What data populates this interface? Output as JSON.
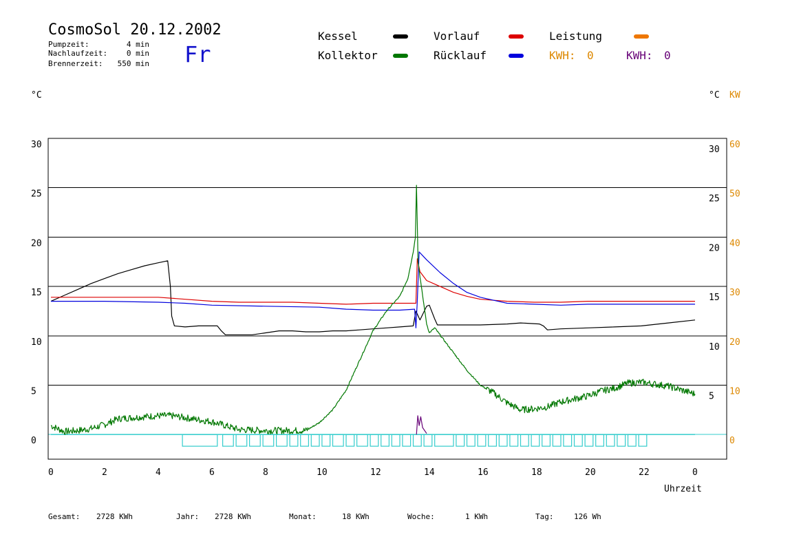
{
  "header": {
    "title": "CosmoSol 20.12.2002",
    "day": "Fr",
    "stats": [
      {
        "label": "Pumpzeit:",
        "value": "4 min"
      },
      {
        "label": "Nachlaufzeit:",
        "value": "0 min"
      },
      {
        "label": "Brennerzeit:",
        "value": "550 min"
      }
    ]
  },
  "legend": {
    "items": [
      {
        "label": "Kessel",
        "color": "#000000"
      },
      {
        "label": "Vorlauf",
        "color": "#dd0000"
      },
      {
        "label": "Leistung",
        "color": "#ee7700"
      },
      {
        "label": "Kollektor",
        "color": "#007700"
      },
      {
        "label": "Rücklauf",
        "color": "#0000dd"
      }
    ],
    "kwh": [
      {
        "label": "KWH:",
        "value": "0",
        "color": "#dd8800"
      },
      {
        "label": "KWH:",
        "value": "0",
        "color": "#660077"
      }
    ]
  },
  "footer": {
    "items": [
      {
        "label": "Gesamt:",
        "value": "2728 KWh"
      },
      {
        "label": "Jahr:",
        "value": "2728 KWh"
      },
      {
        "label": "Monat:",
        "value": "18 KWh"
      },
      {
        "label": "Woche:",
        "value": "1 KWh"
      },
      {
        "label": "Tag:",
        "value": "126 Wh"
      }
    ]
  },
  "chart_data": {
    "type": "line",
    "xlabel": "Uhrzeit",
    "ylabel_left": "°C",
    "ylabel_right": [
      "°C",
      "KW"
    ],
    "xlim": [
      0,
      24
    ],
    "ylim": [
      -2.5,
      30
    ],
    "ylim_kw": [
      -5,
      60
    ],
    "x_ticks": [
      "0",
      "2",
      "4",
      "6",
      "8",
      "10",
      "12",
      "14",
      "16",
      "18",
      "20",
      "22",
      "0"
    ],
    "y_ticks_left": [
      "0",
      "5",
      "10",
      "15",
      "20",
      "25",
      "30"
    ],
    "y_ticks_right": [
      "5",
      "10",
      "15",
      "20",
      "25",
      "30"
    ],
    "y_ticks_kw": [
      "0",
      "10",
      "20",
      "30",
      "40",
      "50",
      "60"
    ],
    "grid": "horizontal",
    "colors": {
      "kessel": "#000000",
      "vorlauf": "#dd0000",
      "ruecklauf": "#0000dd",
      "kollektor": "#007700",
      "pump": "#33cccc",
      "leistung": "#ee7700",
      "spike": "#660077"
    },
    "series": [
      {
        "name": "Kessel",
        "points": [
          [
            0,
            13.5
          ],
          [
            0.5,
            14.1
          ],
          [
            1,
            14.7
          ],
          [
            1.5,
            15.3
          ],
          [
            2,
            15.8
          ],
          [
            2.5,
            16.3
          ],
          [
            3,
            16.7
          ],
          [
            3.5,
            17.1
          ],
          [
            4,
            17.4
          ],
          [
            4.35,
            17.6
          ],
          [
            4.45,
            15
          ],
          [
            4.5,
            12
          ],
          [
            4.6,
            11
          ],
          [
            5,
            10.9
          ],
          [
            5.5,
            11
          ],
          [
            6.2,
            11.0
          ],
          [
            6.35,
            10.5
          ],
          [
            6.5,
            10.1
          ],
          [
            7,
            10.1
          ],
          [
            7.5,
            10.1
          ],
          [
            8,
            10.3
          ],
          [
            8.5,
            10.5
          ],
          [
            9,
            10.5
          ],
          [
            9.5,
            10.4
          ],
          [
            10,
            10.4
          ],
          [
            10.5,
            10.5
          ],
          [
            11,
            10.5
          ],
          [
            11.5,
            10.6
          ],
          [
            12,
            10.7
          ],
          [
            12.5,
            10.8
          ],
          [
            13,
            10.9
          ],
          [
            13.5,
            11.0
          ],
          [
            13.6,
            12.5
          ],
          [
            13.75,
            11.6
          ],
          [
            14,
            13.0
          ],
          [
            14.1,
            13.1
          ],
          [
            14.3,
            11.7
          ],
          [
            14.4,
            11.1
          ],
          [
            15,
            11.1
          ],
          [
            16,
            11.1
          ],
          [
            17,
            11.2
          ],
          [
            17.5,
            11.3
          ],
          [
            18.2,
            11.2
          ],
          [
            18.35,
            11.0
          ],
          [
            18.5,
            10.6
          ],
          [
            19,
            10.7
          ],
          [
            20,
            10.8
          ],
          [
            21,
            10.9
          ],
          [
            22,
            11.0
          ],
          [
            23,
            11.3
          ],
          [
            24,
            11.6
          ]
        ]
      },
      {
        "name": "Vorlauf",
        "points": [
          [
            0,
            13.9
          ],
          [
            2,
            13.9
          ],
          [
            4,
            13.9
          ],
          [
            5,
            13.7
          ],
          [
            6,
            13.5
          ],
          [
            7,
            13.4
          ],
          [
            8,
            13.4
          ],
          [
            9,
            13.4
          ],
          [
            10,
            13.3
          ],
          [
            11,
            13.2
          ],
          [
            12,
            13.3
          ],
          [
            13,
            13.3
          ],
          [
            13.6,
            13.3
          ],
          [
            13.65,
            17.8
          ],
          [
            13.75,
            16.5
          ],
          [
            14,
            15.6
          ],
          [
            14.5,
            15.0
          ],
          [
            15,
            14.4
          ],
          [
            15.5,
            14.0
          ],
          [
            16,
            13.7
          ],
          [
            16.5,
            13.6
          ],
          [
            17,
            13.5
          ],
          [
            18,
            13.4
          ],
          [
            19,
            13.4
          ],
          [
            20,
            13.5
          ],
          [
            21,
            13.5
          ],
          [
            22,
            13.5
          ],
          [
            23,
            13.5
          ],
          [
            24,
            13.5
          ]
        ]
      },
      {
        "name": "Rücklauf",
        "points": [
          [
            0,
            13.5
          ],
          [
            2,
            13.5
          ],
          [
            4,
            13.4
          ],
          [
            5,
            13.3
          ],
          [
            6,
            13.1
          ],
          [
            8,
            13.0
          ],
          [
            10,
            12.9
          ],
          [
            11,
            12.7
          ],
          [
            12,
            12.6
          ],
          [
            13,
            12.6
          ],
          [
            13.55,
            12.7
          ],
          [
            13.6,
            10.8
          ],
          [
            13.65,
            13.5
          ],
          [
            13.72,
            18.5
          ],
          [
            14,
            17.7
          ],
          [
            14.5,
            16.4
          ],
          [
            15,
            15.3
          ],
          [
            15.5,
            14.4
          ],
          [
            16,
            13.9
          ],
          [
            16.5,
            13.6
          ],
          [
            17,
            13.3
          ],
          [
            18,
            13.2
          ],
          [
            19,
            13.1
          ],
          [
            20,
            13.2
          ],
          [
            21,
            13.2
          ],
          [
            22,
            13.2
          ],
          [
            23,
            13.2
          ],
          [
            24,
            13.2
          ]
        ]
      },
      {
        "name": "Kollektor",
        "points": [
          [
            0,
            0.9
          ],
          [
            0.5,
            0.3
          ],
          [
            1,
            0.4
          ],
          [
            1.5,
            0.6
          ],
          [
            2,
            1.0
          ],
          [
            2.5,
            1.6
          ],
          [
            3,
            1.7
          ],
          [
            3.5,
            1.8
          ],
          [
            4,
            1.9
          ],
          [
            4.5,
            1.9
          ],
          [
            5,
            1.7
          ],
          [
            5.5,
            1.5
          ],
          [
            6,
            1.3
          ],
          [
            6.5,
            0.9
          ],
          [
            7,
            0.5
          ],
          [
            8,
            0.4
          ],
          [
            9,
            0.4
          ],
          [
            9.5,
            0.4
          ],
          [
            10,
            1.2
          ],
          [
            10.5,
            2.5
          ],
          [
            11,
            4.5
          ],
          [
            11.5,
            7.5
          ],
          [
            12,
            10.5
          ],
          [
            12.5,
            12.5
          ],
          [
            13,
            14.0
          ],
          [
            13.3,
            15.8
          ],
          [
            13.5,
            18.5
          ],
          [
            13.58,
            20.0
          ],
          [
            13.62,
            25.3
          ],
          [
            13.68,
            17.5
          ],
          [
            13.8,
            15.0
          ],
          [
            14,
            11.2
          ],
          [
            14.1,
            10.3
          ],
          [
            14.3,
            10.8
          ],
          [
            14.8,
            9.0
          ],
          [
            15.5,
            6.5
          ],
          [
            16,
            5.0
          ],
          [
            16.5,
            4.2
          ],
          [
            17,
            3.2
          ],
          [
            17.5,
            2.5
          ],
          [
            18,
            2.6
          ],
          [
            18.5,
            2.8
          ],
          [
            19,
            3.3
          ],
          [
            19.5,
            3.6
          ],
          [
            20,
            3.9
          ],
          [
            20.5,
            4.4
          ],
          [
            21,
            4.7
          ],
          [
            21.5,
            5.2
          ],
          [
            22,
            5.3
          ],
          [
            22.5,
            5.1
          ],
          [
            23,
            4.9
          ],
          [
            23.5,
            4.5
          ],
          [
            24,
            4.1
          ]
        ]
      },
      {
        "name": "Leistung",
        "points": [
          [
            13.62,
            0.0
          ],
          [
            13.67,
            1.9
          ],
          [
            13.72,
            0.9
          ],
          [
            13.78,
            1.8
          ],
          [
            13.85,
            0.7
          ],
          [
            14.0,
            0.1
          ]
        ]
      }
    ],
    "pump_baseline": 0,
    "pump_blocks": [
      [
        4.9,
        6.2
      ],
      [
        6.4,
        6.8
      ],
      [
        6.9,
        7.3
      ],
      [
        7.4,
        7.8
      ],
      [
        7.9,
        8.3
      ],
      [
        8.4,
        8.8
      ],
      [
        8.9,
        9.2
      ],
      [
        9.3,
        9.6
      ],
      [
        9.7,
        10.0
      ],
      [
        10.1,
        10.4
      ],
      [
        10.5,
        10.9
      ],
      [
        11.0,
        11.3
      ],
      [
        11.4,
        11.8
      ],
      [
        11.9,
        12.2
      ],
      [
        12.3,
        12.6
      ],
      [
        12.7,
        13.0
      ],
      [
        13.1,
        13.4
      ],
      [
        13.5,
        13.8
      ],
      [
        13.9,
        14.2
      ],
      [
        14.3,
        15.0
      ],
      [
        15.1,
        15.4
      ],
      [
        15.5,
        15.8
      ],
      [
        15.9,
        16.2
      ],
      [
        16.3,
        16.6
      ],
      [
        16.7,
        17.0
      ],
      [
        17.1,
        17.4
      ],
      [
        17.5,
        17.8
      ],
      [
        17.9,
        18.2
      ],
      [
        18.3,
        18.6
      ],
      [
        18.7,
        19.0
      ],
      [
        19.1,
        19.4
      ],
      [
        19.5,
        19.8
      ],
      [
        19.9,
        20.2
      ],
      [
        20.3,
        20.6
      ],
      [
        20.7,
        21.0
      ],
      [
        21.1,
        21.4
      ],
      [
        21.5,
        21.8
      ],
      [
        21.9,
        22.2
      ]
    ]
  }
}
